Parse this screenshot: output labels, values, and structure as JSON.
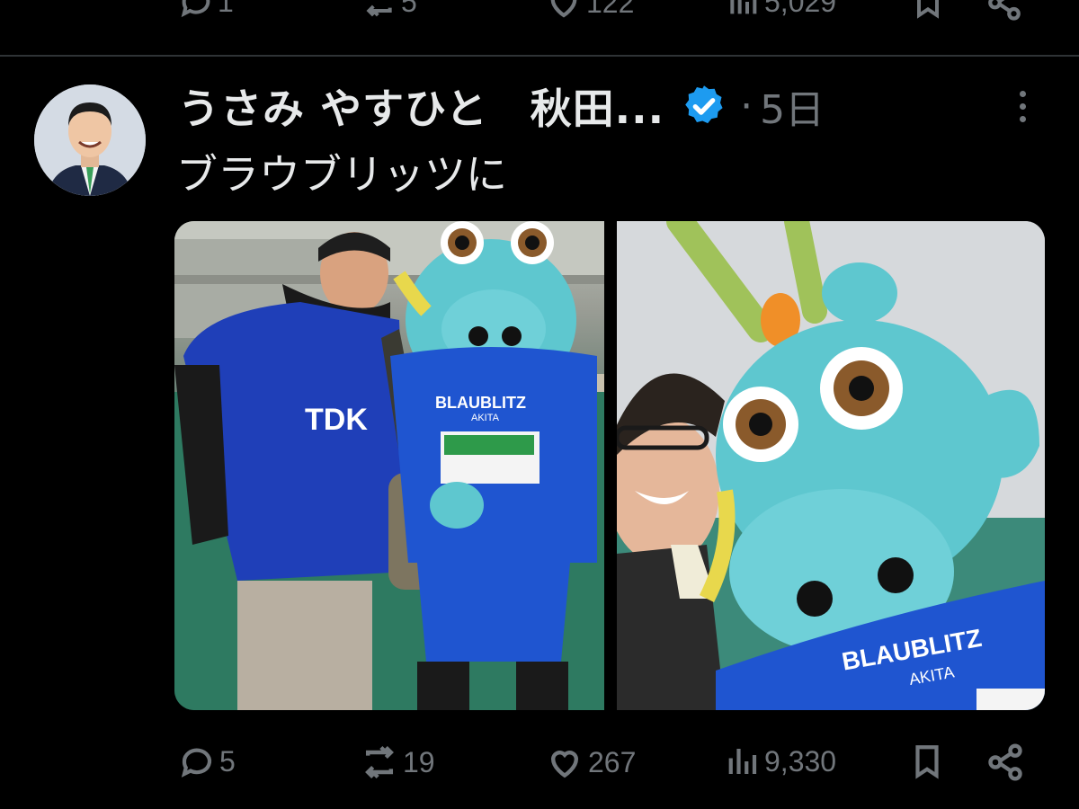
{
  "prev_tweet": {
    "replies": "1",
    "reposts": "5",
    "likes": "122",
    "views": "5,029"
  },
  "tweet": {
    "author_name": "うさみ やすひと　秋田...",
    "timestamp": "5日",
    "separator": "·",
    "text": "ブラウブリッツに",
    "replies": "5",
    "reposts": "19",
    "likes": "267",
    "views": "9,330"
  },
  "icons": {
    "reply": "speech-bubble-icon",
    "repost": "repost-arrows-icon",
    "like": "heart-icon",
    "views": "bar-chart-icon",
    "bookmark": "bookmark-icon",
    "share": "share-icon",
    "verified": "verified-badge-icon",
    "more": "more-vertical-icon"
  },
  "colors": {
    "background": "#000000",
    "text": "#e7e9ea",
    "muted": "#71767b",
    "verified": "#1d9bf0",
    "divider": "#2f3336"
  },
  "media": {
    "photo1_jersey_text": "TDK",
    "photo1_mascot_text": "BLAUBLITZ",
    "photo1_mascot_sub": "AKITA",
    "photo2_mascot_text": "BLAUBLITZ",
    "photo2_mascot_sub": "AKITA"
  }
}
